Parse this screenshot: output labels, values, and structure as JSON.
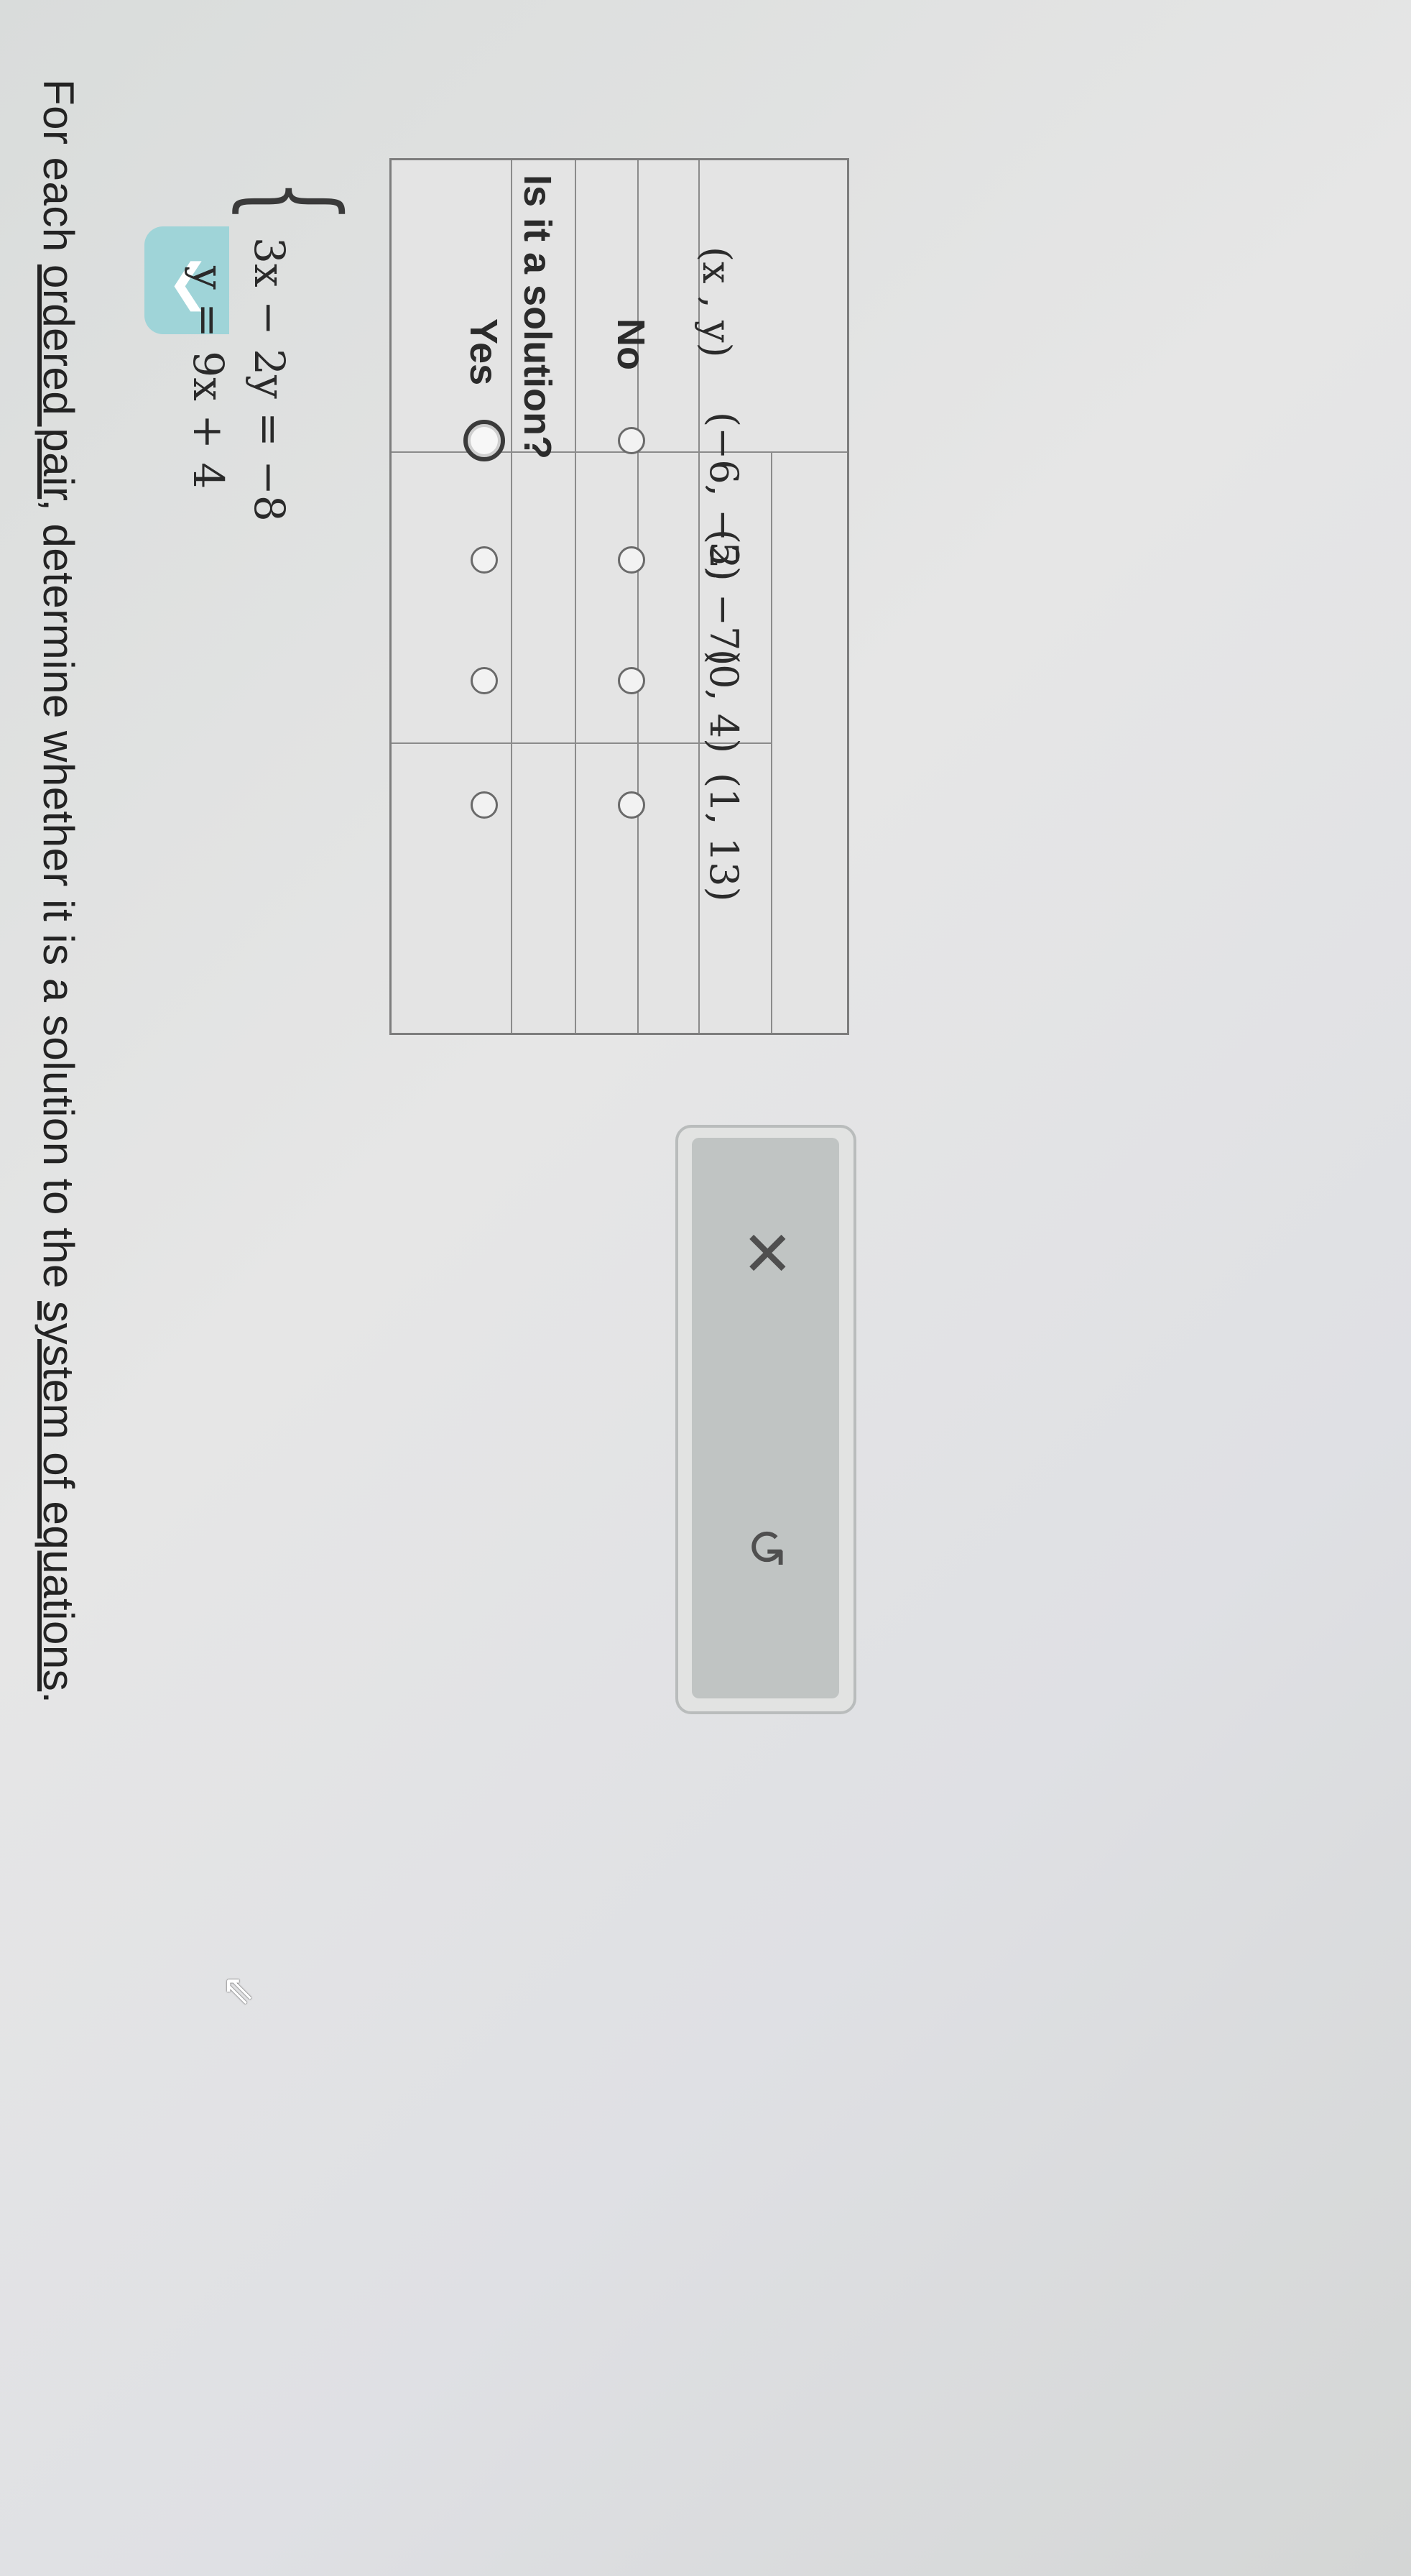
{
  "instruction": {
    "prefix": "For each ",
    "link1": "ordered pair",
    "middle": ", determine whether it is a solution to the ",
    "link2": "system of equations",
    "suffix": "."
  },
  "system": {
    "eq1": "y = 9x + 4",
    "eq2": "3x − 2y = −8"
  },
  "table": {
    "col_pair": "(x , y)",
    "header": "Is it a solution?",
    "col_yes": "Yes",
    "col_no": "No",
    "rows": [
      {
        "pair": "(−6, −5)",
        "answer": "yes"
      },
      {
        "pair": "(2, −7)",
        "answer": null
      },
      {
        "pair": "(0, 4)",
        "answer": null
      },
      {
        "pair": "(1, 13)",
        "answer": null
      }
    ]
  },
  "panel": {
    "clear_icon": "✕",
    "undo_icon": "↺"
  },
  "icons": {
    "collapse": "chevron-up-icon",
    "clear": "close-icon",
    "undo": "undo-icon",
    "cursor": "mouse-pointer-icon"
  },
  "colors": {
    "collapse_tab": "#9fd4d8",
    "panel_bg": "#c0c4c3"
  }
}
